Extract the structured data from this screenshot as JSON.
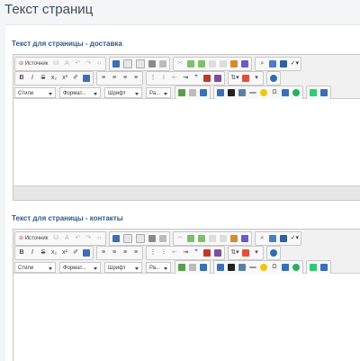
{
  "page": {
    "title": "Текст страниц"
  },
  "sections": [
    {
      "label": "Текст для страницы - доставка"
    },
    {
      "label": "Текст для страницы - контакты"
    }
  ],
  "toolbar": {
    "source_label": "Источник",
    "bold": "B",
    "italic": "I",
    "strike": "S",
    "subscript": "x₂",
    "superscript": "x²",
    "styles_combo": "Стили",
    "format_combo": "Формат...",
    "font_combo": "Шрифт",
    "size_combo": "Ра..."
  },
  "colors": {
    "title": "#3e4d5c",
    "section_label": "#2d5b85",
    "toolbar_bg": "#f1f1f1",
    "editor_border": "#c6c6c6"
  }
}
